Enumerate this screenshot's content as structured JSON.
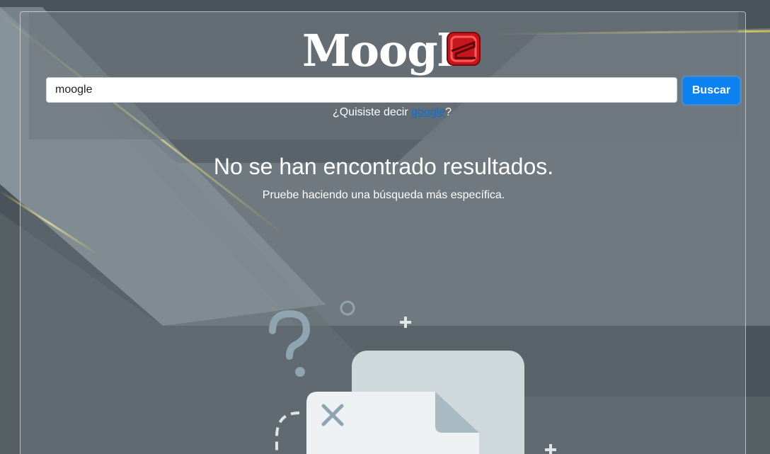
{
  "brand": {
    "logo_text": "Moogl",
    "logo_letter": "e",
    "logo_accent_color": "#c4161c"
  },
  "search": {
    "value": "moogle",
    "placeholder": "",
    "button_label": "Buscar"
  },
  "suggestion": {
    "prefix": "¿Quisiste decir ",
    "link_text": "google",
    "suffix": "?"
  },
  "results": {
    "title": "No se han encontrado resultados.",
    "hint": "Pruebe haciendo una búsqueda más específica."
  },
  "illustration": {
    "icons": [
      "question-mark-icon",
      "plus-icon",
      "circle-icon",
      "close-x-icon",
      "document-icon"
    ]
  },
  "colors": {
    "button": "#0b82f0",
    "link": "#0b6fd6",
    "highlight": "#ffe24a"
  }
}
